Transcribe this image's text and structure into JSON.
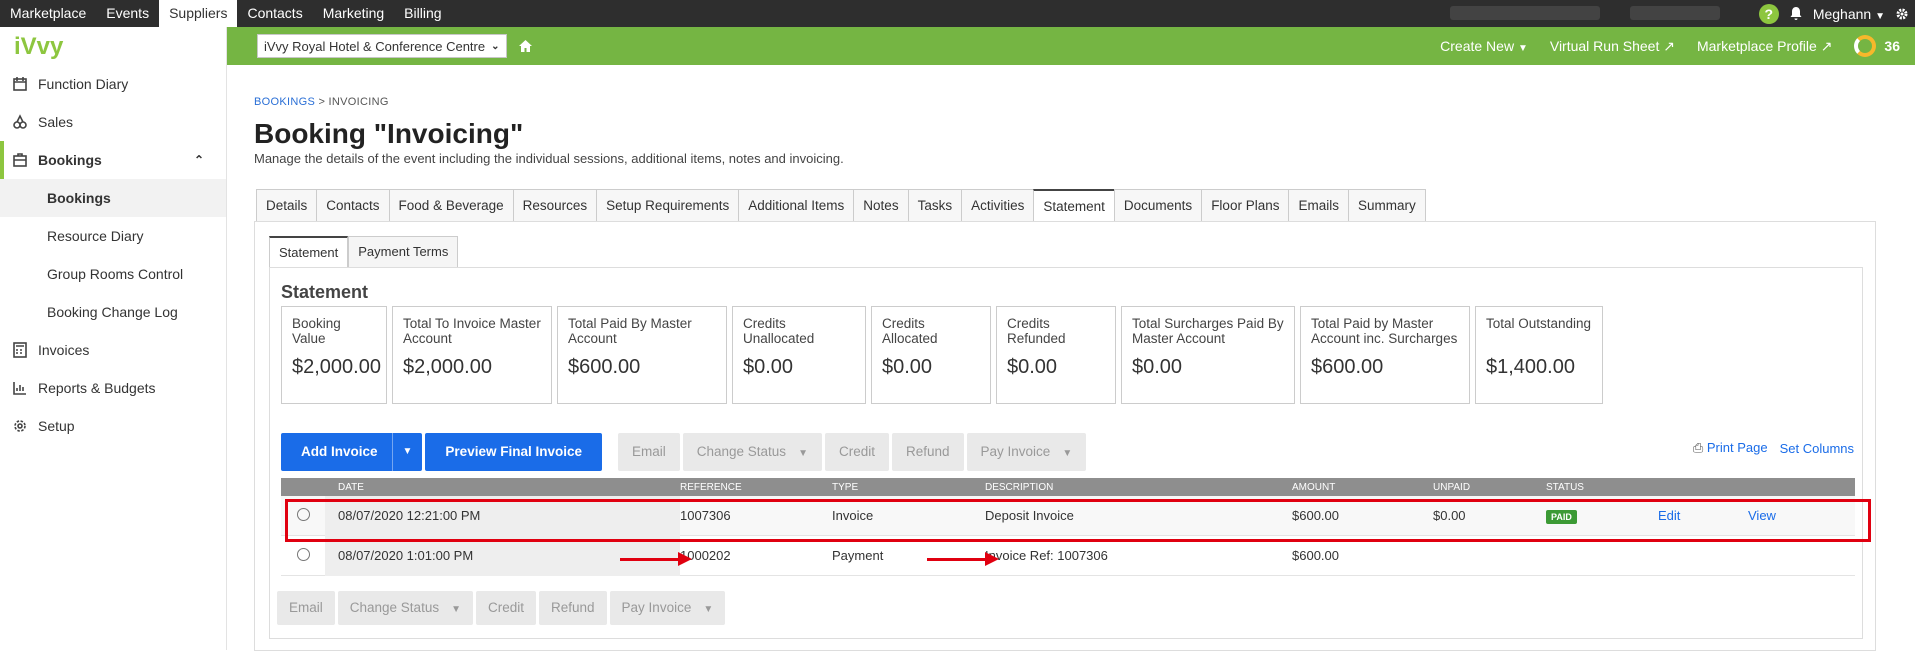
{
  "topnav": {
    "items": [
      "Marketplace",
      "Events",
      "Suppliers",
      "Contacts",
      "Marketing",
      "Billing"
    ],
    "user": "Meghann"
  },
  "logo": "iVvy",
  "sidebar": {
    "items": [
      {
        "label": "Function Diary",
        "icon": "calendar-icon"
      },
      {
        "label": "Sales",
        "icon": "sales-icon"
      },
      {
        "label": "Bookings",
        "icon": "briefcase-icon"
      },
      {
        "label": "Bookings"
      },
      {
        "label": "Resource Diary"
      },
      {
        "label": "Group Rooms Control"
      },
      {
        "label": "Booking Change Log"
      },
      {
        "label": "Invoices",
        "icon": "calculator-icon"
      },
      {
        "label": "Reports & Budgets",
        "icon": "chart-icon"
      },
      {
        "label": "Setup",
        "icon": "gear-icon"
      }
    ]
  },
  "header": {
    "venue": "iVvy Royal Hotel & Conference Centre",
    "create_new": "Create New",
    "virtual_run_sheet": "Virtual Run Sheet",
    "marketplace_profile": "Marketplace Profile",
    "score": "36"
  },
  "breadcrumb": {
    "root": "BOOKINGS",
    "sep": ">",
    "current": "INVOICING"
  },
  "page": {
    "title": "Booking \"Invoicing\"",
    "description": "Manage the details of the event including the individual sessions, additional items, notes and invoicing."
  },
  "tabs": [
    "Details",
    "Contacts",
    "Food & Beverage",
    "Resources",
    "Setup Requirements",
    "Additional Items",
    "Notes",
    "Tasks",
    "Activities",
    "Statement",
    "Documents",
    "Floor Plans",
    "Emails",
    "Summary"
  ],
  "subtabs": [
    "Statement",
    "Payment Terms"
  ],
  "statement": {
    "title": "Statement",
    "cards": [
      {
        "label": "Booking Value",
        "value": "$2,000.00"
      },
      {
        "label": "Total To Invoice Master Account",
        "value": "$2,000.00"
      },
      {
        "label": "Total Paid By Master Account",
        "value": "$600.00"
      },
      {
        "label": "Credits Unallocated",
        "value": "$0.00"
      },
      {
        "label": "Credits Allocated",
        "value": "$0.00"
      },
      {
        "label": "Credits Refunded",
        "value": "$0.00"
      },
      {
        "label": "Total Surcharges Paid By Master Account",
        "value": "$0.00"
      },
      {
        "label": "Total Paid by Master Account inc. Surcharges",
        "value": "$600.00"
      },
      {
        "label": "Total Outstanding",
        "value": "$1,400.00"
      }
    ]
  },
  "actions": {
    "add_invoice": "Add Invoice",
    "preview": "Preview Final Invoice",
    "email": "Email",
    "change_status": "Change Status",
    "credit": "Credit",
    "refund": "Refund",
    "pay_invoice": "Pay Invoice",
    "print_page": "Print Page",
    "set_columns": "Set Columns"
  },
  "table": {
    "headers": [
      "DATE",
      "REFERENCE",
      "TYPE",
      "DESCRIPTION",
      "AMOUNT",
      "UNPAID",
      "STATUS"
    ],
    "rows": [
      {
        "date": "08/07/2020 12:21:00 PM",
        "reference": "1007306",
        "type": "Invoice",
        "description": "Deposit Invoice",
        "amount": "$600.00",
        "unpaid": "$0.00",
        "status": "PAID",
        "edit": "Edit",
        "view": "View"
      },
      {
        "date": "08/07/2020 1:01:00 PM",
        "reference": "1000202",
        "type": "Payment",
        "description": "Invoice Ref: 1007306",
        "amount": "$600.00"
      }
    ]
  }
}
